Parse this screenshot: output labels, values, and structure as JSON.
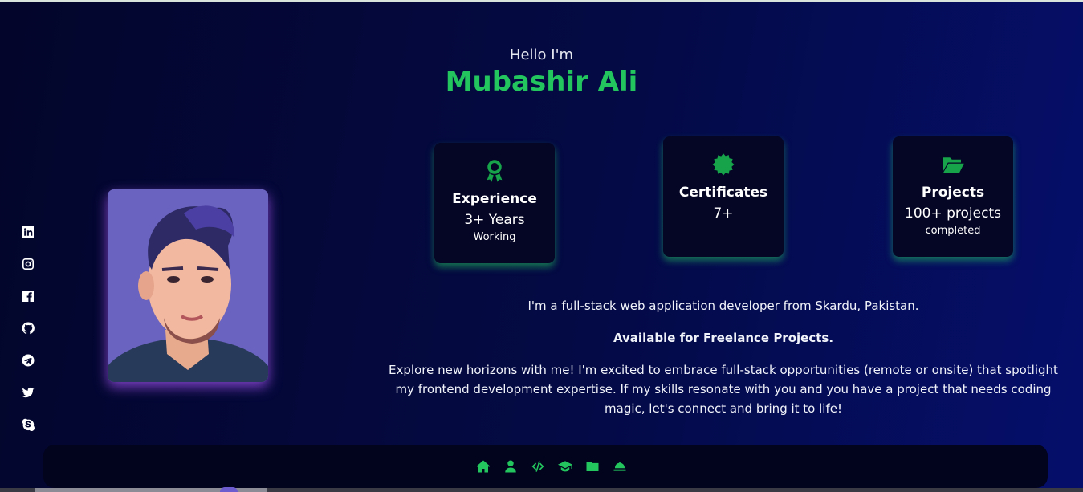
{
  "hero": {
    "greeting": "Hello I'm",
    "name": "Mubashir Ali"
  },
  "socials": [
    {
      "icon": "linkedin-icon"
    },
    {
      "icon": "instagram-icon"
    },
    {
      "icon": "facebook-icon"
    },
    {
      "icon": "github-icon"
    },
    {
      "icon": "telegram-icon"
    },
    {
      "icon": "twitter-icon"
    },
    {
      "icon": "skype-icon"
    }
  ],
  "cards": [
    {
      "icon": "award-icon",
      "title": "Experience",
      "value": "3+ Years",
      "sub": "Working"
    },
    {
      "icon": "certificate-icon",
      "title": "Certificates",
      "value": "7+",
      "sub": ""
    },
    {
      "icon": "folder-open-icon",
      "title": "Projects",
      "value": "100+ projects",
      "sub": "completed"
    }
  ],
  "bio": {
    "intro": "I'm a full-stack web application developer from Skardu, Pakistan.",
    "availability": "Available for Freelance Projects.",
    "pitch": "Explore new horizons with me! I'm excited to embrace full-stack opportunities (remote or onsite) that spotlight my frontend development expertise. If my skills resonate with you and you have a project that needs coding magic, let's connect and bring it to life!"
  },
  "nav": [
    {
      "icon": "home-icon"
    },
    {
      "icon": "user-icon"
    },
    {
      "icon": "code-icon"
    },
    {
      "icon": "graduation-cap-icon"
    },
    {
      "icon": "folder-icon"
    },
    {
      "icon": "service-bell-icon"
    }
  ],
  "colors": {
    "accent": "#22c55e",
    "accent_dark": "#16a34a",
    "avatar_glow": "#a855f7",
    "card_bg": "#050525",
    "nav_bg": "#02031d"
  }
}
